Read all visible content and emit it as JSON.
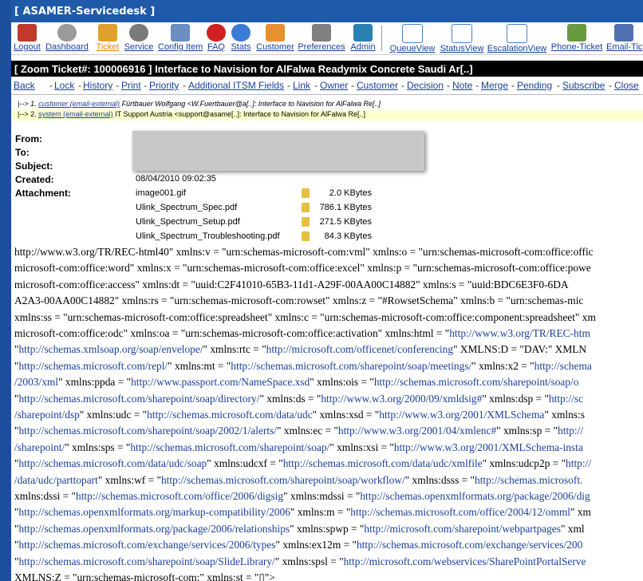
{
  "window": {
    "title": "[ ASAMER-Servicedesk ]"
  },
  "toolbar": {
    "items": [
      {
        "label": "Logout",
        "icon": "logout-icon"
      },
      {
        "label": "Dashboard",
        "icon": "dashboard-icon"
      },
      {
        "label": "Ticket",
        "icon": "ticket-icon"
      },
      {
        "label": "Service",
        "icon": "service-icon"
      },
      {
        "label": "Config Item",
        "icon": "config-item-icon"
      },
      {
        "label": "FAQ",
        "icon": "faq-icon"
      },
      {
        "label": "Stats",
        "icon": "stats-icon"
      },
      {
        "label": "Customer",
        "icon": "customer-icon"
      },
      {
        "label": "Preferences",
        "icon": "preferences-icon"
      },
      {
        "label": "Admin",
        "icon": "admin-icon"
      },
      {
        "label": "QueueView",
        "icon": "queue-view-icon"
      },
      {
        "label": "StatusView",
        "icon": "status-view-icon"
      },
      {
        "label": "EscalationView",
        "icon": "escalation-view-icon"
      },
      {
        "label": "Phone-Ticket",
        "icon": "phone-ticket-icon"
      },
      {
        "label": "Email-Tic",
        "icon": "email-ticket-icon"
      }
    ],
    "colors": {
      "logout": "#c0392b",
      "dashboard": "#8a8a8a",
      "ticket": "#e0a030",
      "service": "#7a7a7a",
      "config": "#6a8fc0",
      "faq": "#d02020",
      "stats": "#3a7bd5",
      "customer": "#e89030",
      "preferences": "#808080",
      "admin": "#2a80b0",
      "view": "#4a7fc8",
      "phone": "#6a9a40",
      "email": "#5070b0"
    }
  },
  "zoom": {
    "title": "[ Zoom Ticket#: 100006916 ] Interface to Navision for AlFalwa Readymix Concrete Saudi Ar[..]"
  },
  "actions": [
    "Back",
    "Lock",
    "History",
    "Print",
    "Priority",
    "Additional ITSM Fields",
    "Link",
    "Owner",
    "Customer",
    "Decision",
    "Note",
    "Merge",
    "Pending",
    "Subscribe",
    "Close"
  ],
  "thread": {
    "row1": {
      "num": "1.",
      "meta": "customer (email-external)",
      "text": "Fürtbauer Wolfgang <W.Fuertbauer@a[..]: Interface to Navision for AlFalwa Re[..]"
    },
    "row2": {
      "num": "2.",
      "meta": "system (email-external)",
      "text": "IT Support Austria <support@asame[..]: Interface to Navision for AlFalwa Re[..]"
    }
  },
  "header": {
    "from_label": "From:",
    "to_label": "To:",
    "subject_label": "Subject:",
    "created_label": "Created:",
    "attachment_label": "Attachment:",
    "created_value": "08/04/2010 09:02:35"
  },
  "attachments": [
    {
      "name": "image001.gif",
      "size": "2.0 KBytes"
    },
    {
      "name": "Ulink_Spectrum_Spec.pdf",
      "size": "786.1 KBytes"
    },
    {
      "name": "Ulink_Spectrum_Setup.pdf",
      "size": "271.5 KBytes"
    },
    {
      "name": "Ulink_Spectrum_Troubleshooting.pdf",
      "size": "84.3 KBytes"
    }
  ],
  "body_lines": [
    [
      {
        "t": "http://www.w3.org/TR/REC-html40\" xmlns:v = \"urn:schemas-microsoft-com:vml\" xmlns:o = \"urn:schemas-microsoft-com:office:offic"
      }
    ],
    [
      {
        "t": "microsoft-com:office:word\" xmlns:x = \"urn:schemas-microsoft-com:office:excel\" xmlns:p = \"urn:schemas-microsoft-com:office:powe"
      }
    ],
    [
      {
        "t": "microsoft-com:office:access\" xmlns:dt = \"uuid:C2F41010-65B3-11d1-A29F-00AA00C14882\" xmlns:s = \"uuid:BDC6E3F0-6DA"
      }
    ],
    [
      {
        "t": "A2A3-00AA00C14882\" xmlns:rs = \"urn:schemas-microsoft-com:rowset\" xmlns:z = \"#RowsetSchema\" xmlns:b = \"urn:schemas-mic"
      }
    ],
    [
      {
        "t": "xmlns:ss = \"urn:schemas-microsoft-com:office:spreadsheet\" xmlns:c = \"urn:schemas-microsoft-com:office:component:spreadsheet\" xm"
      }
    ],
    [
      {
        "t": "microsoft-com:office:odc\" xmlns:oa = \"urn:schemas-microsoft-com:office:activation\" xmlns:html = \""
      },
      {
        "a": "http://www.w3.org/TR/REC-htm"
      }
    ],
    [
      {
        "t": "\""
      },
      {
        "a": "http://schemas.xmlsoap.org/soap/envelope/"
      },
      {
        "t": "\" xmlns:rtc = \""
      },
      {
        "a": "http://microsoft.com/officenet/conferencing"
      },
      {
        "t": "\" XMLNS:D = \"DAV:\" XMLN"
      }
    ],
    [
      {
        "t": "\""
      },
      {
        "a": "http://schemas.microsoft.com/repl/"
      },
      {
        "t": "\" xmlns:mt = \""
      },
      {
        "a": "http://schemas.microsoft.com/sharepoint/soap/meetings/"
      },
      {
        "t": "\" xmlns:x2 = \""
      },
      {
        "a": "http://schema"
      }
    ],
    [
      {
        "a": "/2003/xml"
      },
      {
        "t": "\" xmlns:ppda = \""
      },
      {
        "a": "http://www.passport.com/NameSpace.xsd"
      },
      {
        "t": "\" xmlns:ois = \""
      },
      {
        "a": "http://schemas.microsoft.com/sharepoint/soap/o"
      }
    ],
    [
      {
        "t": "\""
      },
      {
        "a": "http://schemas.microsoft.com/sharepoint/soap/directory/"
      },
      {
        "t": "\" xmlns:ds = \""
      },
      {
        "a": "http://www.w3.org/2000/09/xmldsig#"
      },
      {
        "t": "\" xmlns:dsp = \""
      },
      {
        "a": "http://sc"
      }
    ],
    [
      {
        "a": "/sharepoint/dsp"
      },
      {
        "t": "\" xmlns:udc = \""
      },
      {
        "a": "http://schemas.microsoft.com/data/udc"
      },
      {
        "t": "\" xmlns:xsd = \""
      },
      {
        "a": "http://www.w3.org/2001/XMLSchema"
      },
      {
        "t": "\" xmlns:s"
      }
    ],
    [
      {
        "t": "\""
      },
      {
        "a": "http://schemas.microsoft.com/sharepoint/soap/2002/1/alerts/"
      },
      {
        "t": "\" xmlns:ec = \""
      },
      {
        "a": "http://www.w3.org/2001/04/xmlenc#"
      },
      {
        "t": "\" xmlns:sp = \""
      },
      {
        "a": "http://"
      }
    ],
    [
      {
        "a": "/sharepoint/"
      },
      {
        "t": "\" xmlns:sps = \""
      },
      {
        "a": "http://schemas.microsoft.com/sharepoint/soap/"
      },
      {
        "t": "\" xmlns:xsi = \""
      },
      {
        "a": "http://www.w3.org/2001/XMLSchema-insta"
      }
    ],
    [
      {
        "t": "\""
      },
      {
        "a": "http://schemas.microsoft.com/data/udc/soap"
      },
      {
        "t": "\" xmlns:udcxf = \""
      },
      {
        "a": "http://schemas.microsoft.com/data/udc/xmlfile"
      },
      {
        "t": "\" xmlns:udcp2p = \""
      },
      {
        "a": "http://"
      }
    ],
    [
      {
        "a": "/data/udc/parttopart"
      },
      {
        "t": "\" xmlns:wf = \""
      },
      {
        "a": "http://schemas.microsoft.com/sharepoint/soap/workflow/"
      },
      {
        "t": "\" xmlns:dsss = \""
      },
      {
        "a": "http://schemas.microsoft."
      }
    ],
    [
      {
        "t": "xmlns:dssi = \""
      },
      {
        "a": "http://schemas.microsoft.com/office/2006/digsig"
      },
      {
        "t": "\" xmlns:mdssi = \""
      },
      {
        "a": "http://schemas.openxmlformats.org/package/2006/dig"
      }
    ],
    [
      {
        "t": "\""
      },
      {
        "a": "http://schemas.openxmlformats.org/markup-compatibility/2006"
      },
      {
        "t": "\" xmlns:m = \""
      },
      {
        "a": "http://schemas.microsoft.com/office/2004/12/omml"
      },
      {
        "t": "\" xm"
      }
    ],
    [
      {
        "t": "\""
      },
      {
        "a": "http://schemas.openxmlformats.org/package/2006/relationships"
      },
      {
        "t": "\" xmlns:spwp = \""
      },
      {
        "a": "http://microsoft.com/sharepoint/webpartpages"
      },
      {
        "t": "\" xml"
      }
    ],
    [
      {
        "t": "\""
      },
      {
        "a": "http://schemas.microsoft.com/exchange/services/2006/types"
      },
      {
        "t": "\" xmlns:ex12m = \""
      },
      {
        "a": "http://schemas.microsoft.com/exchange/services/200"
      }
    ],
    [
      {
        "t": "\""
      },
      {
        "a": "http://schemas.microsoft.com/sharepoint/soap/SlideLibrary/"
      },
      {
        "t": "\" xmlns:spsl = \""
      },
      {
        "a": "http://microsoft.com/webservices/SharePointPortalServe"
      }
    ],
    [
      {
        "t": "XMLNS:Z = \"urn:schemas-microsoft-com:\" xmlns:st = \"▯\">"
      }
    ]
  ]
}
